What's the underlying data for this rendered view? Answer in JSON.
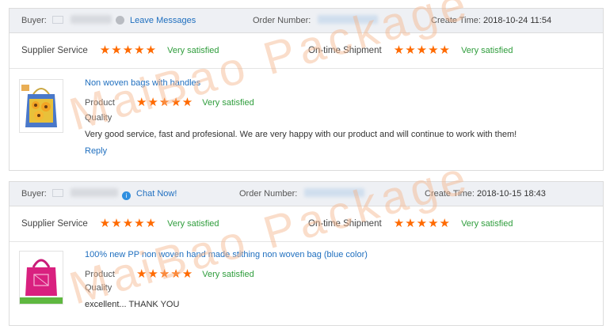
{
  "reviews": [
    {
      "buyer_label": "Buyer:",
      "contact_label": "Leave Messages",
      "order_label": "Order Number:",
      "create_label": "Create Time:",
      "create_time": "2018-10-24 11:54",
      "supplier_label": "Supplier Service",
      "supplier_stars": 5,
      "supplier_text": "Very satisfied",
      "shipment_label": "On-time Shipment",
      "shipment_stars": 5,
      "shipment_text": "Very satisfied",
      "product_name": "Non woven bags with handles",
      "product_label": "Product",
      "product_stars": 5,
      "product_text": "Very satisfied",
      "quality_label": "Quality",
      "comment": "Very good service, fast and profesional. We are very happy with our product and will continue to work with them!",
      "reply_label": "Reply"
    },
    {
      "buyer_label": "Buyer:",
      "contact_label": "Chat Now!",
      "order_label": "Order Number:",
      "create_label": "Create Time:",
      "create_time": "2018-10-15 18:43",
      "supplier_label": "Supplier Service",
      "supplier_stars": 5,
      "supplier_text": "Very satisfied",
      "shipment_label": "On-time Shipment",
      "shipment_stars": 5,
      "shipment_text": "Very satisfied",
      "product_name": "100% new PP non woven hand made stithing non woven bag (blue color)",
      "product_label": "Product",
      "product_stars": 5,
      "product_text": "Very satisfied",
      "quality_label": "Quality",
      "comment": "excellent... THANK YOU"
    }
  ],
  "stars": {
    "five": "★★★★★"
  },
  "watermark": {
    "text": "MaiBao Package",
    "color": "#f4b38a"
  },
  "colors": {
    "star": "#ff6a00",
    "satisfied": "#2f9d3c",
    "link": "#1f6fbf",
    "header_bg": "#eef0f4"
  }
}
